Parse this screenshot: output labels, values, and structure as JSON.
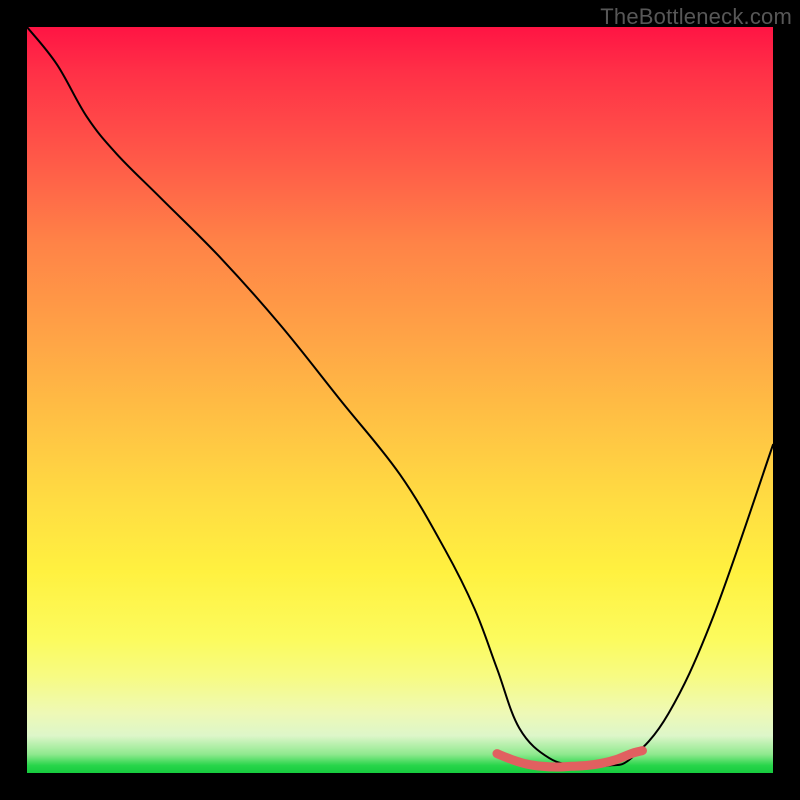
{
  "watermark": "TheBottleneck.com",
  "chart_data": {
    "type": "line",
    "title": "",
    "xlabel": "",
    "ylabel": "",
    "xlim": [
      0,
      100
    ],
    "ylim": [
      0,
      100
    ],
    "series": [
      {
        "name": "main-curve",
        "color": "#000000",
        "x": [
          0,
          4,
          8,
          12,
          18,
          26,
          34,
          42,
          50,
          56,
          60,
          63,
          66,
          70,
          74,
          78,
          81,
          86,
          92,
          100
        ],
        "y": [
          100,
          95,
          88,
          83,
          77,
          69,
          60,
          50,
          40,
          30,
          22,
          14,
          6,
          2,
          1,
          1,
          2,
          8,
          21,
          44
        ]
      },
      {
        "name": "valley-marker",
        "color": "#e16060",
        "x": [
          63,
          65,
          67,
          69,
          71,
          73,
          75,
          77,
          79,
          81,
          82.5
        ],
        "y": [
          2.6,
          1.8,
          1.2,
          0.9,
          0.8,
          0.9,
          1.0,
          1.3,
          1.8,
          2.6,
          3.0
        ]
      }
    ],
    "gradient_stops": [
      {
        "pos": 0,
        "color": "#ff1444"
      },
      {
        "pos": 6,
        "color": "#ff3047"
      },
      {
        "pos": 18,
        "color": "#ff5a48"
      },
      {
        "pos": 29,
        "color": "#ff8347"
      },
      {
        "pos": 41,
        "color": "#ffa246"
      },
      {
        "pos": 52,
        "color": "#ffbf44"
      },
      {
        "pos": 63,
        "color": "#ffdb42"
      },
      {
        "pos": 73,
        "color": "#fff140"
      },
      {
        "pos": 82,
        "color": "#fcfb5d"
      },
      {
        "pos": 87,
        "color": "#f7fb82"
      },
      {
        "pos": 92,
        "color": "#eef9b6"
      },
      {
        "pos": 95,
        "color": "#ddf6c9"
      },
      {
        "pos": 97.5,
        "color": "#8fe98e"
      },
      {
        "pos": 99,
        "color": "#27d54a"
      },
      {
        "pos": 100,
        "color": "#16cb3e"
      }
    ]
  }
}
